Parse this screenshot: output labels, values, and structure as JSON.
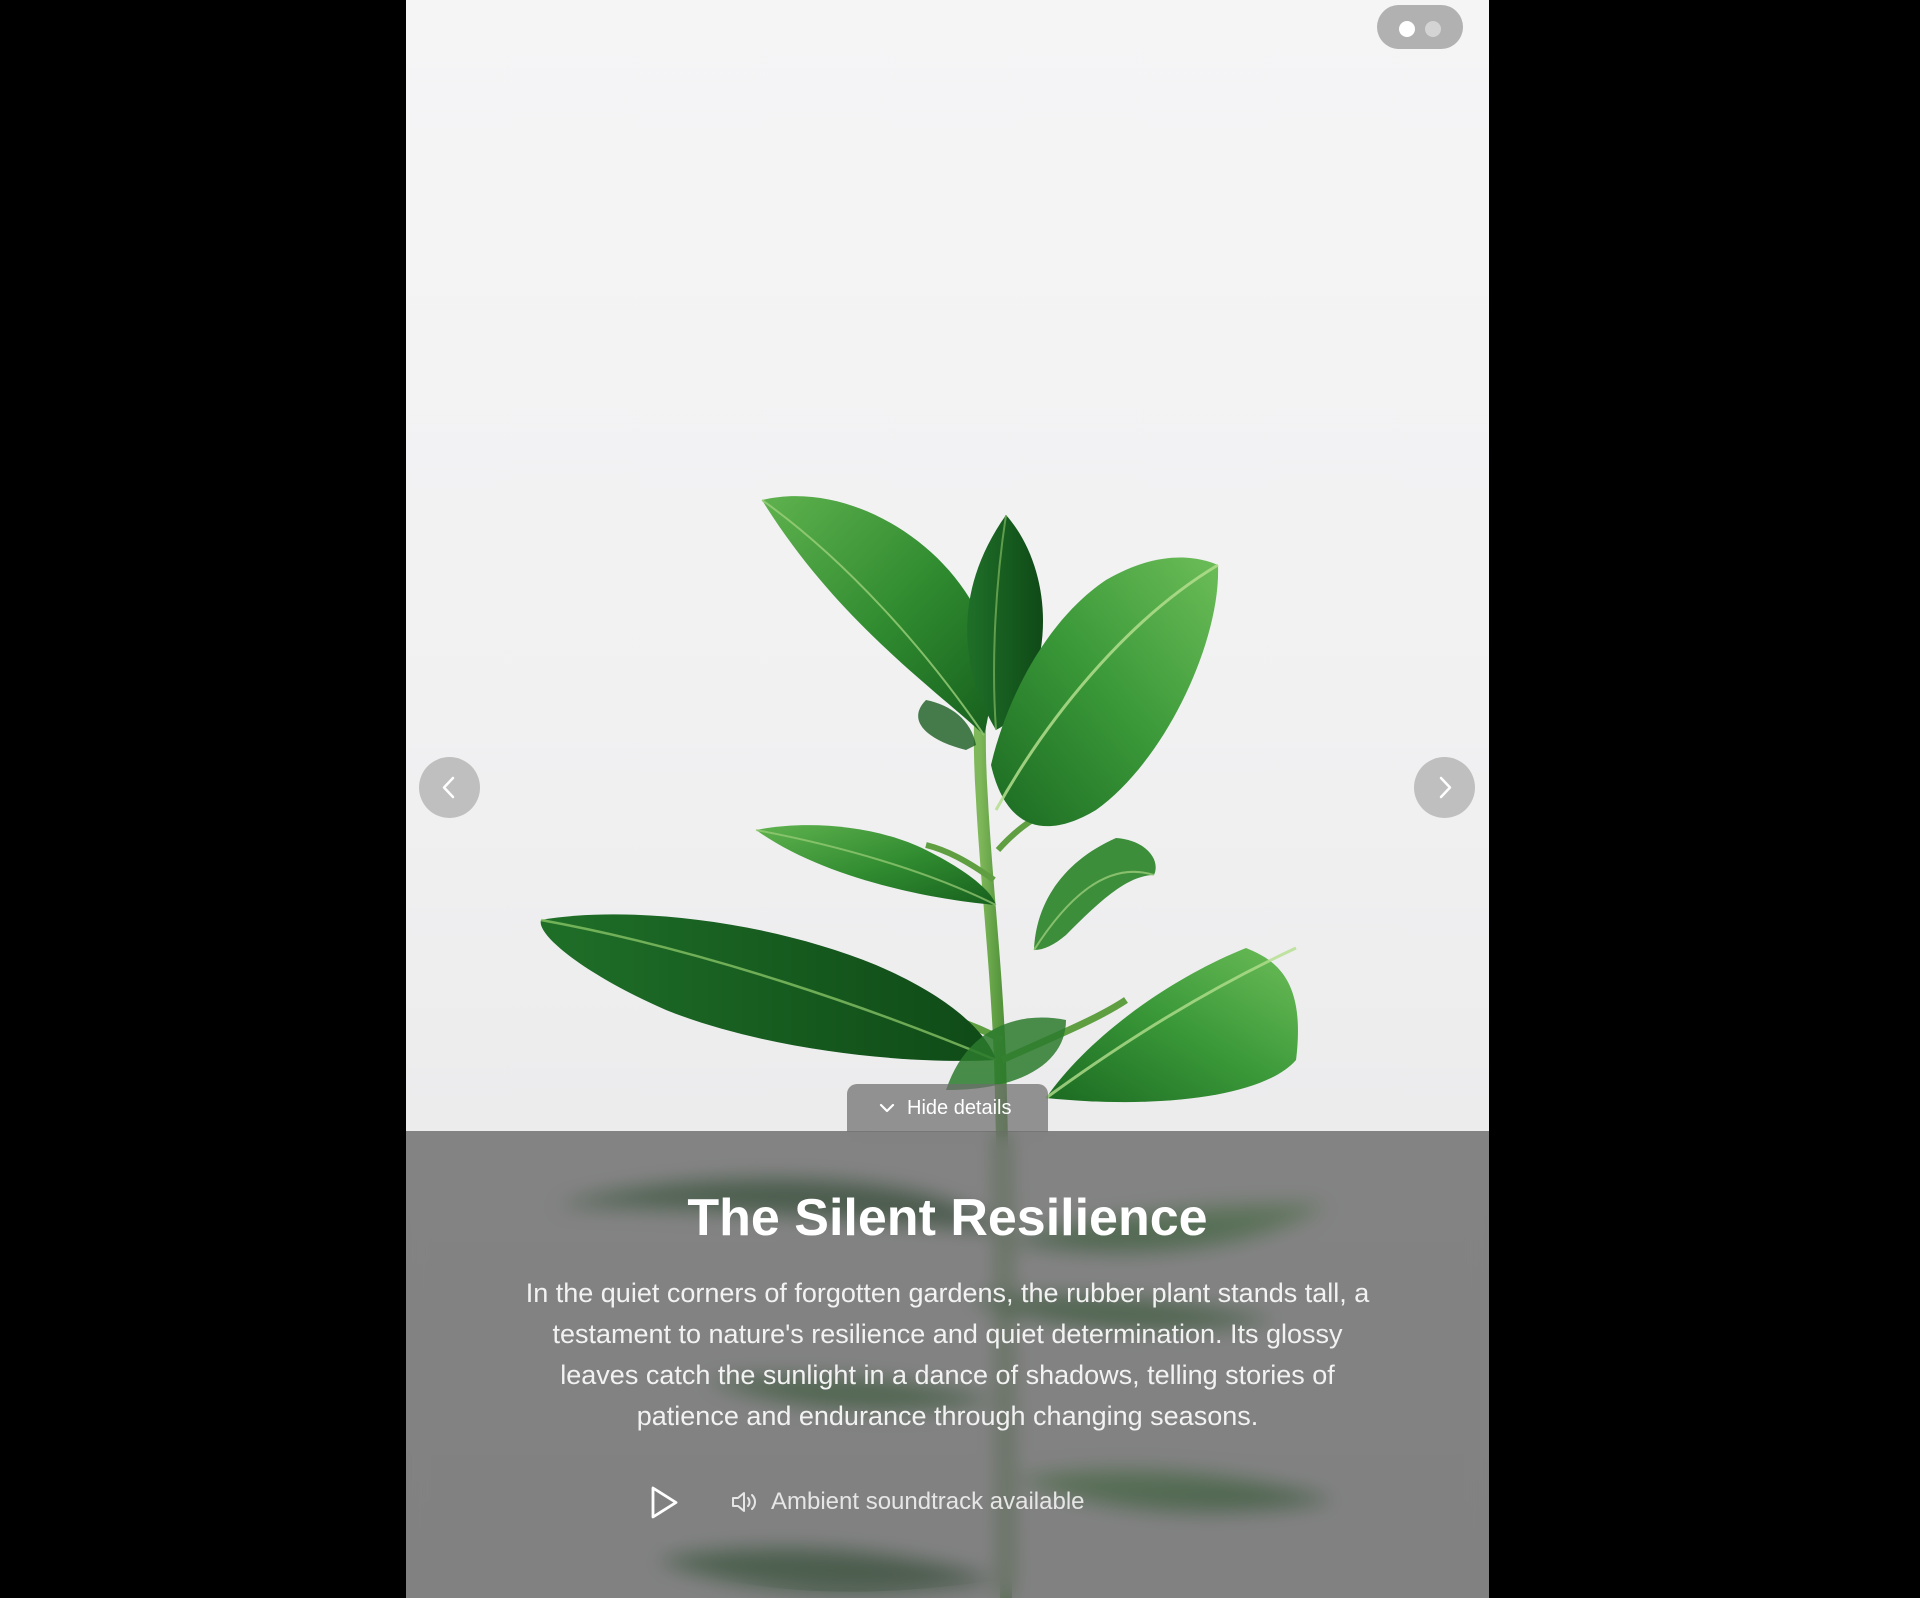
{
  "slideshow": {
    "slide_count": 2,
    "active_slide": 1,
    "prev_icon": "chevron-left-icon",
    "next_icon": "chevron-right-icon"
  },
  "details_toggle": {
    "label": "Hide details",
    "icon": "chevron-down-icon"
  },
  "story": {
    "title": "The Silent Resilience",
    "description": "In the quiet corners of forgotten gardens, the rubber plant stands tall, a testament to nature's resilience and quiet determination. Its glossy leaves catch the sunlight in a dance of shadows, telling stories of patience and endurance through changing seasons."
  },
  "audio": {
    "play_icon": "play-icon",
    "sound_icon": "speaker-icon",
    "label": "Ambient soundtrack available"
  },
  "colors": {
    "page_background": "#000000",
    "photo_background": "#f1f1f2",
    "leaf_green": "#3f9a3c",
    "panel_overlay": "#5f5f5f"
  }
}
